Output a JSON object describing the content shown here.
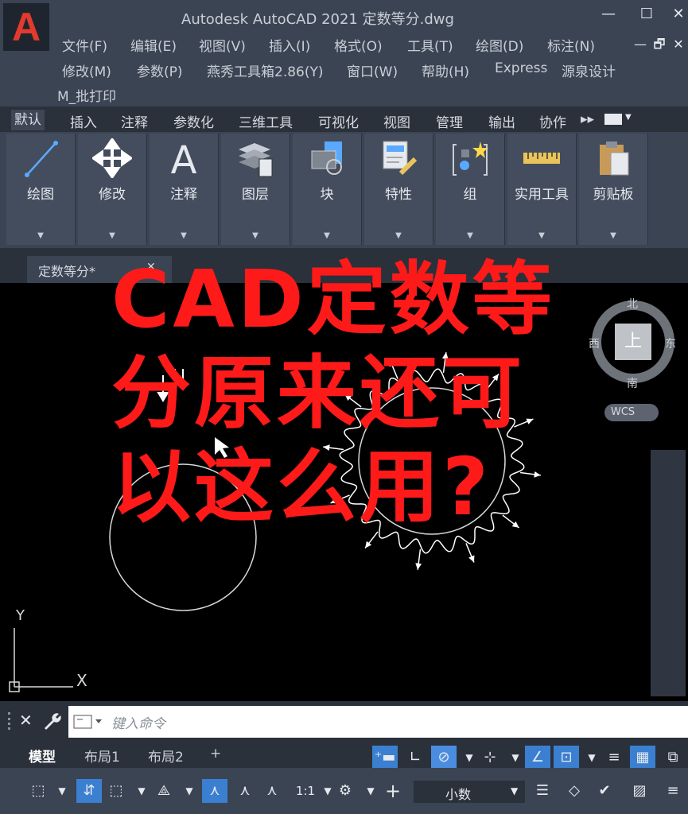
{
  "app": {
    "title": "Autodesk AutoCAD 2021    定数等分.dwg",
    "logo_letter": "A",
    "accent": "#e23b2e"
  },
  "window_controls": {
    "minimize": "—",
    "maximize": "☐",
    "close": "✕",
    "restore": "🗗",
    "inner_close": "✕",
    "inner_min": "—"
  },
  "menu": {
    "row1": [
      "文件(F)",
      "编辑(E)",
      "视图(V)",
      "插入(I)",
      "格式(O)",
      "工具(T)",
      "绘图(D)",
      "标注(N)"
    ],
    "row2": [
      "修改(M)",
      "参数(P)",
      "燕秀工具箱2.86(Y)",
      "窗口(W)",
      "帮助(H)",
      "Express",
      "源泉设计"
    ],
    "row3": [
      "M_批打印"
    ]
  },
  "ribbon_tabs": [
    "默认",
    "插入",
    "注释",
    "参数化",
    "三维工具",
    "可视化",
    "视图",
    "管理",
    "输出",
    "协作",
    "▸▸"
  ],
  "ribbon_panels": [
    "绘图",
    "修改",
    "注释",
    "图层",
    "块",
    "特性",
    "组",
    "实用工具",
    "剪贴板"
  ],
  "doc_tab": {
    "label": "定数等分*",
    "close": "✕"
  },
  "overlay_text": [
    "CAD定数等",
    "分原来还可",
    "以这么用?"
  ],
  "viewcube": {
    "north": "北",
    "south": "南",
    "west": "西",
    "east": "东",
    "face": "上",
    "wcs": "WCS"
  },
  "ucs": {
    "y": "Y",
    "x": "X"
  },
  "command": {
    "placeholder": "键入命令",
    "close_icon": "✕",
    "wrench_icon": "🔧"
  },
  "layout_tabs": [
    "模型",
    "布局1",
    "布局2",
    "+"
  ],
  "status": {
    "scale": "1:1",
    "units": "小数"
  }
}
